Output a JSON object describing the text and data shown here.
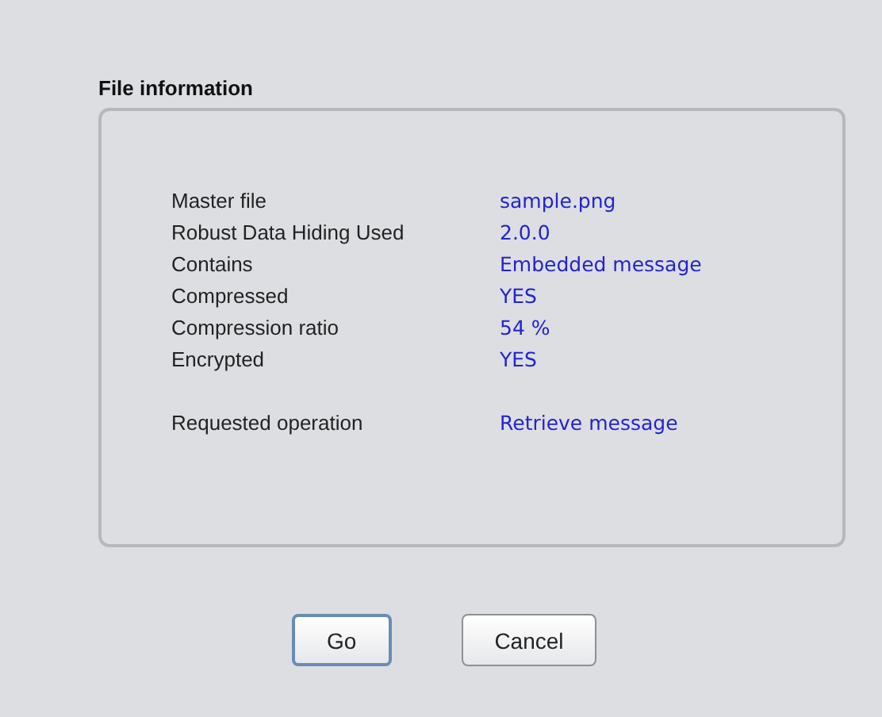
{
  "panel": {
    "title": "File information",
    "rows": [
      {
        "label": "Master file",
        "value": "sample.png"
      },
      {
        "label": "Robust Data Hiding Used",
        "value": "2.0.0"
      },
      {
        "label": "Contains",
        "value": "Embedded message"
      },
      {
        "label": "Compressed",
        "value": "YES"
      },
      {
        "label": "Compression ratio",
        "value": "54 %"
      },
      {
        "label": "Encrypted",
        "value": "YES"
      }
    ],
    "operation": {
      "label": "Requested operation",
      "value": "Retrieve message"
    }
  },
  "buttons": [
    {
      "label": "Go",
      "focused": true
    },
    {
      "label": "Cancel",
      "focused": false
    }
  ]
}
